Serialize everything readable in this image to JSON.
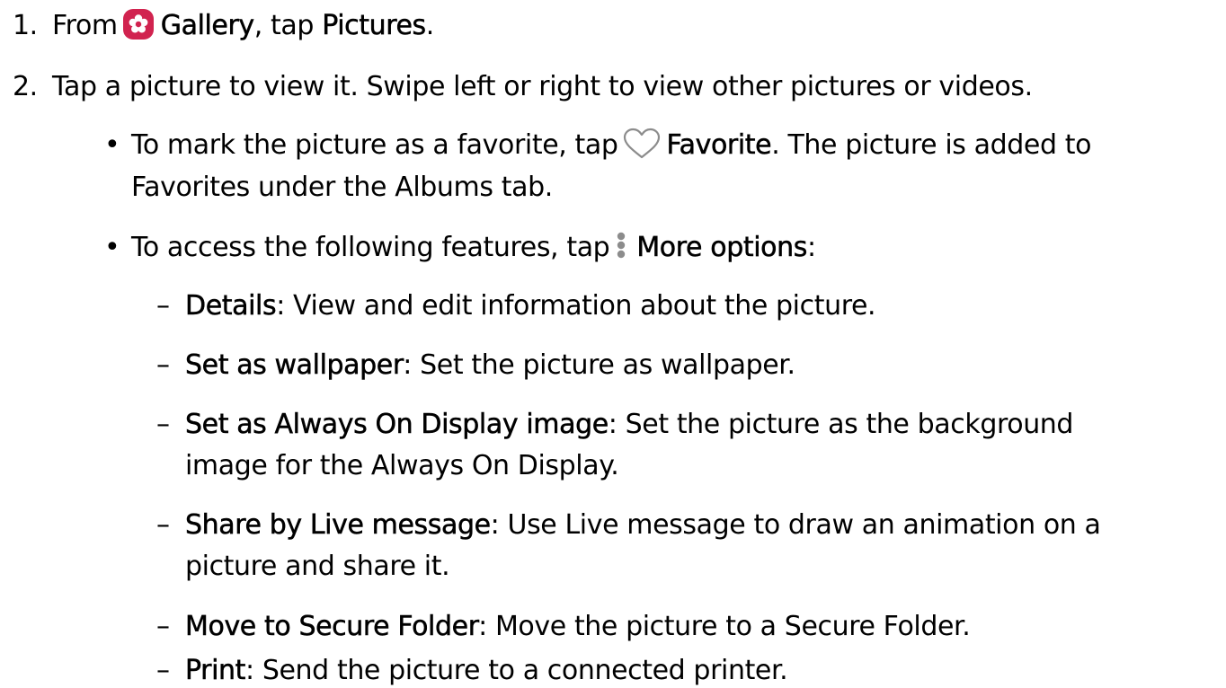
{
  "steps": {
    "step1": {
      "number": "1.",
      "prefix": "From",
      "gallery_label": "Gallery",
      "middle": ", tap",
      "target": "Pictures",
      "end": "."
    },
    "step2": {
      "number": "2.",
      "text": "Tap a picture to view it. Swipe left or right to view other pictures or videos."
    }
  },
  "bullets": {
    "favorite": {
      "symbol": "•",
      "prefix": "To mark the picture as a favorite, tap",
      "label": "Favorite",
      "rest": ". The picture is added to",
      "line2": "Favorites under the Albums tab."
    },
    "more": {
      "symbol": "•",
      "prefix": "To access the following features, tap",
      "label": "More options",
      "end": ":"
    }
  },
  "options": [
    {
      "dash": "–",
      "term": "Details",
      "text": ": View and edit information about the picture.",
      "line2": ""
    },
    {
      "dash": "–",
      "term": "Set as wallpaper",
      "text": ": Set the picture as wallpaper.",
      "line2": ""
    },
    {
      "dash": "–",
      "term": "Set as Always On Display image",
      "text": ": Set the picture as the background",
      "line2": "image for the Always On Display."
    },
    {
      "dash": "–",
      "term": "Share by Live message",
      "text": ": Use Live message to draw an animation on a",
      "line2": "picture and share it."
    },
    {
      "dash": "–",
      "term": "Move to Secure Folder",
      "text": ": Move the picture to a Secure Folder.",
      "line2": ""
    },
    {
      "dash": "–",
      "term": "Print",
      "text": ": Send the picture to a connected printer.",
      "line2": ""
    }
  ],
  "icons": {
    "gallery": "gallery-flower-icon",
    "favorite": "heart-outline-icon",
    "more": "more-options-vertical-dots-icon"
  },
  "colors": {
    "gallery_icon_bg": "#d1234f",
    "icon_gray": "#8c8c8c",
    "text": "#000000"
  }
}
